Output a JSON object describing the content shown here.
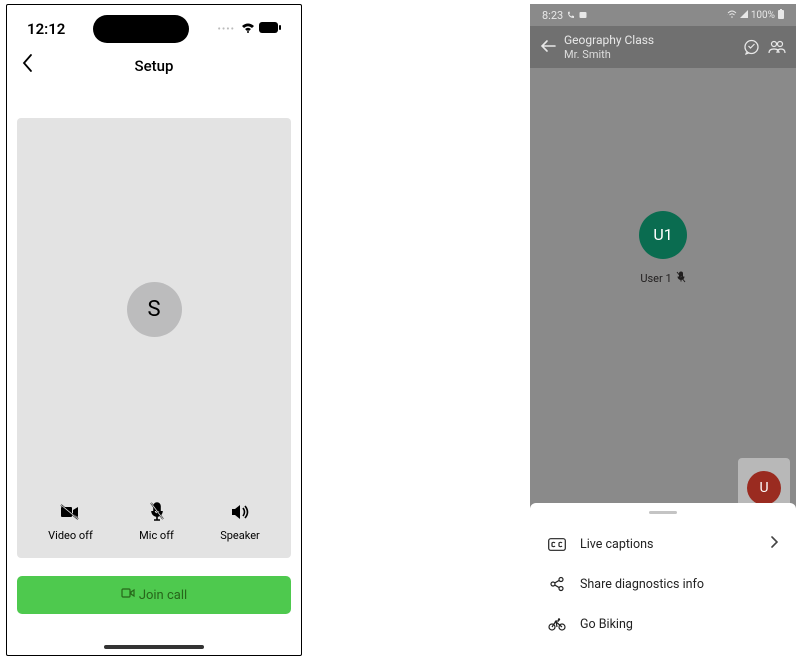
{
  "left": {
    "status": {
      "time": "12:12"
    },
    "nav": {
      "title": "Setup"
    },
    "avatar": {
      "initial": "S"
    },
    "controls": {
      "video": "Video off",
      "mic": "Mic off",
      "speaker": "Speaker"
    },
    "join_button": "Join call"
  },
  "right": {
    "status": {
      "time": "8:23",
      "battery": "100%"
    },
    "header": {
      "title": "Geography Class",
      "subtitle": "Mr. Smith"
    },
    "participant": {
      "avatar_initial": "U1",
      "name": "User 1"
    },
    "pip": {
      "initial": "U"
    },
    "sheet": {
      "live_captions": "Live captions",
      "share_diagnostics": "Share diagnostics info",
      "go_biking": "Go Biking"
    }
  }
}
